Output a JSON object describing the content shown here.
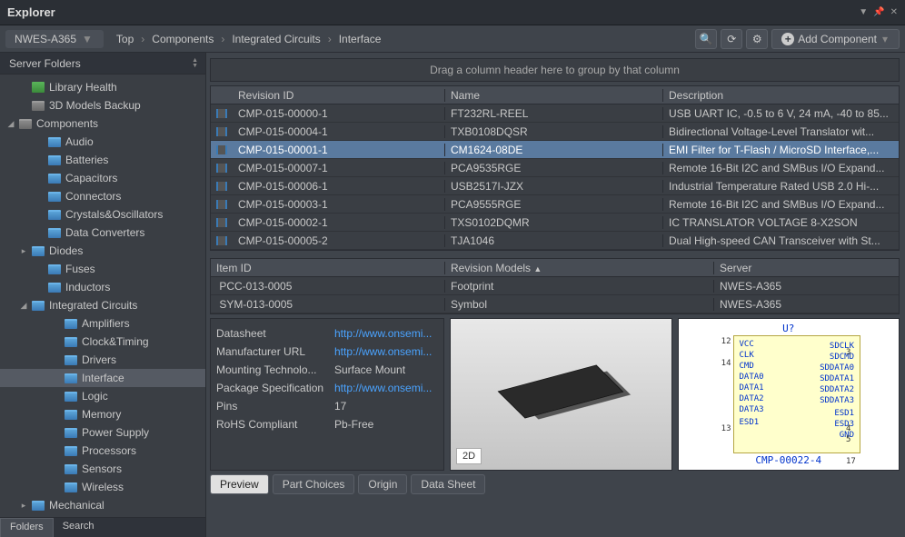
{
  "window": {
    "title": "Explorer"
  },
  "breadcrumb": {
    "workspace": "NWES-A365",
    "parts": [
      "Top",
      "Components",
      "Integrated Circuits",
      "Interface"
    ],
    "add_label": "Add Component"
  },
  "sidebar": {
    "header": "Server Folders",
    "tabs": {
      "folders": "Folders",
      "search": "Search"
    },
    "tree": {
      "library_health": "Library Health",
      "models_backup": "3D Models Backup",
      "components": "Components",
      "audio": "Audio",
      "batteries": "Batteries",
      "capacitors": "Capacitors",
      "connectors": "Connectors",
      "crystals": "Crystals&Oscillators",
      "data_conv": "Data Converters",
      "diodes": "Diodes",
      "fuses": "Fuses",
      "inductors": "Inductors",
      "ic": "Integrated Circuits",
      "amplifiers": "Amplifiers",
      "clock": "Clock&Timing",
      "drivers": "Drivers",
      "interface": "Interface",
      "logic": "Logic",
      "memory": "Memory",
      "power": "Power Supply",
      "processors": "Processors",
      "sensors": "Sensors",
      "wireless": "Wireless",
      "mechanical": "Mechanical"
    }
  },
  "grid": {
    "group_hint": "Drag a column header here to group by that column",
    "headers": {
      "rev": "Revision ID",
      "name": "Name",
      "desc": "Description"
    },
    "rows": [
      {
        "rev": "CMP-015-00000-1",
        "name": "FT232RL-REEL",
        "desc": "USB UART IC, -0.5 to 6 V, 24 mA, -40 to 85..."
      },
      {
        "rev": "CMP-015-00004-1",
        "name": "TXB0108DQSR",
        "desc": "Bidirectional Voltage-Level Translator wit..."
      },
      {
        "rev": "CMP-015-00001-1",
        "name": "CM1624-08DE",
        "desc": "EMI Filter for T-Flash / MicroSD Interface,..."
      },
      {
        "rev": "CMP-015-00007-1",
        "name": "PCA9535RGE",
        "desc": "Remote 16-Bit I2C and SMBus I/O Expand..."
      },
      {
        "rev": "CMP-015-00006-1",
        "name": "USB2517I-JZX",
        "desc": "Industrial Temperature Rated USB 2.0 Hi-..."
      },
      {
        "rev": "CMP-015-00003-1",
        "name": "PCA9555RGE",
        "desc": "Remote 16-Bit I2C and SMBus I/O Expand..."
      },
      {
        "rev": "CMP-015-00002-1",
        "name": "TXS0102DQMR",
        "desc": "IC TRANSLATOR VOLTAGE 8-X2SON"
      },
      {
        "rev": "CMP-015-00005-2",
        "name": "TJA1046",
        "desc": "Dual High-speed CAN Transceiver with St..."
      }
    ],
    "selected": 2
  },
  "models": {
    "headers": {
      "id": "Item ID",
      "rm": "Revision Models",
      "srv": "Server"
    },
    "rows": [
      {
        "id": "PCC-013-0005",
        "rm": "Footprint",
        "srv": "NWES-A365"
      },
      {
        "id": "SYM-013-0005",
        "rm": "Symbol",
        "srv": "NWES-A365"
      }
    ]
  },
  "props": {
    "datasheet_k": "Datasheet",
    "datasheet_v": "http://www.onsemi...",
    "mfr_k": "Manufacturer URL",
    "mfr_v": "http://www.onsemi...",
    "mount_k": "Mounting Technolo...",
    "mount_v": "Surface Mount",
    "pkg_k": "Package Specification",
    "pkg_v": "http://www.onsemi...",
    "pins_k": "Pins",
    "pins_v": "17",
    "rohs_k": "RoHS Compliant",
    "rohs_v": "Pb-Free"
  },
  "render": {
    "badge": "2D"
  },
  "schematic": {
    "ref": "U?",
    "cmp": "CMP-00022-4",
    "left": [
      "VCC",
      "CLK",
      "CMD",
      "DATA0",
      "DATA1",
      "DATA2",
      "DATA3",
      "",
      "ESD1"
    ],
    "right": [
      "",
      "SDCLK",
      "SDCMD",
      "SDDATA0",
      "SDDATA1",
      "SDDATA2",
      "SDDATA3",
      "",
      "ESD1",
      "ESD3",
      "GND"
    ],
    "pins_left": [
      "12",
      "",
      "14",
      "",
      "",
      "",
      "",
      "",
      "13"
    ],
    "pins_right": [
      "",
      "3",
      "",
      "",
      "",
      "",
      "",
      "",
      "4",
      "5",
      "",
      "17"
    ]
  },
  "preview_tabs": {
    "preview": "Preview",
    "part": "Part Choices",
    "origin": "Origin",
    "ds": "Data Sheet"
  }
}
